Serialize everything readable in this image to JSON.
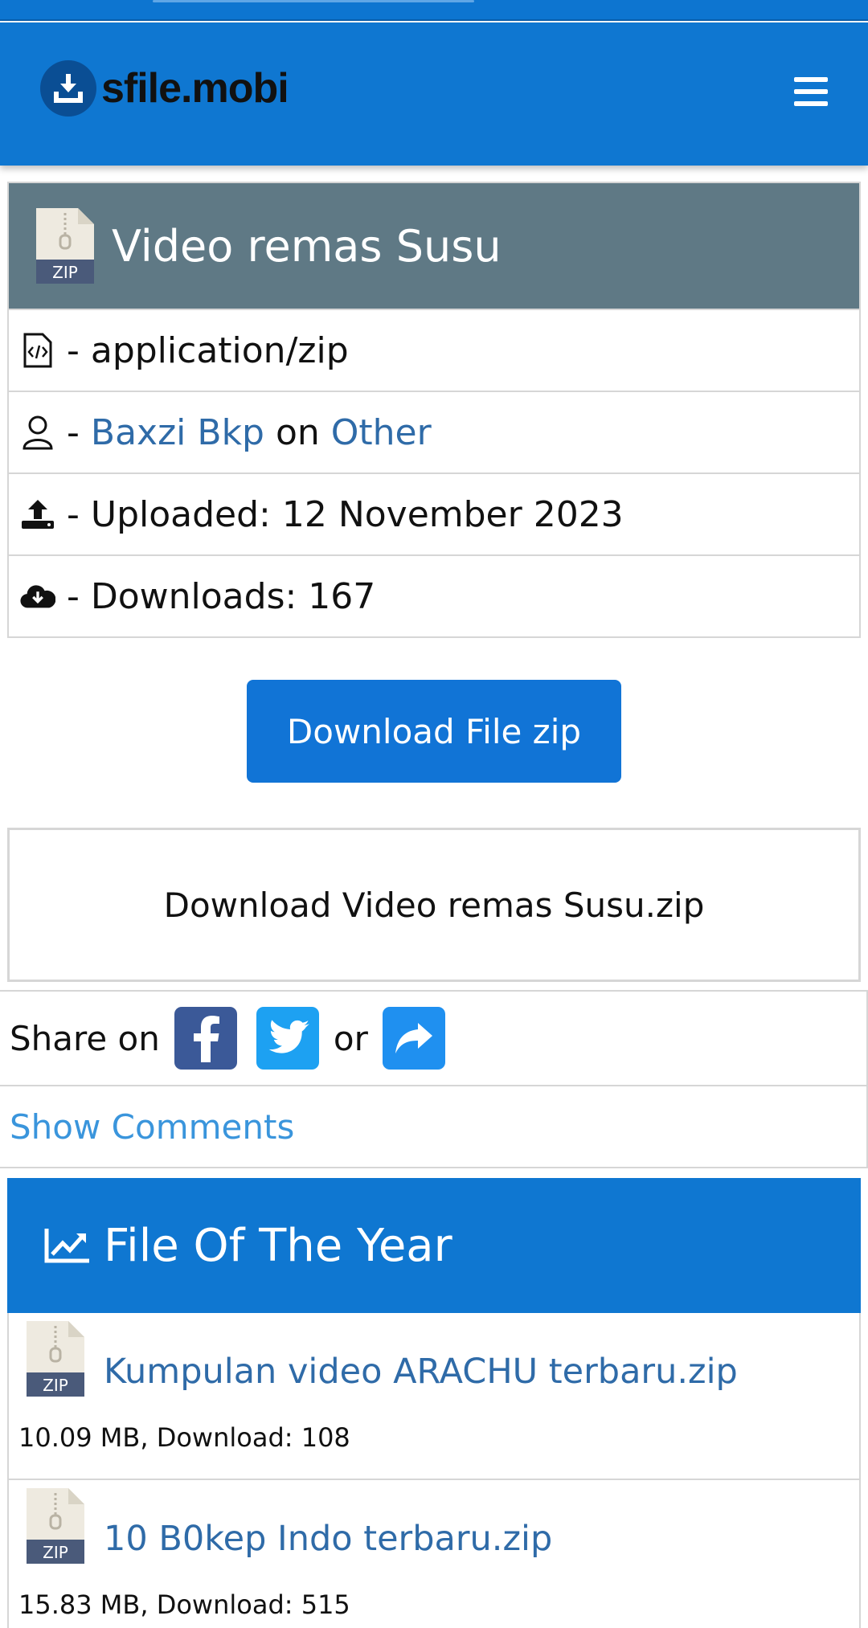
{
  "header": {
    "logo_text": "sfile.mobi",
    "menu_icon": "hamburger-icon"
  },
  "file": {
    "title": "Video remas Susu",
    "type_icon": "zip-file-icon",
    "mime": "- application/zip",
    "uploader_prefix": "- ",
    "uploader": "Baxzi Bkp",
    "on": " on ",
    "category": "Other",
    "uploaded": "- Uploaded: 12 November 2023",
    "downloads": "- Downloads: 167"
  },
  "download_button": "Download File zip",
  "download_box": "Download Video remas Susu.zip",
  "share": {
    "label": "Share on",
    "or": "or",
    "icons": [
      "facebook-icon",
      "twitter-icon",
      "share-icon"
    ]
  },
  "comments_link": "Show Comments",
  "file_of_the_year": {
    "title": "File Of The Year",
    "icon": "chart-line-icon",
    "items": [
      {
        "name": "Kumpulan video ARACHU terbaru.zip",
        "meta": "10.09 MB, Download: 108"
      },
      {
        "name": "10 B0kep Indo terbaru.zip",
        "meta": "15.83 MB, Download: 515"
      }
    ]
  },
  "colors": {
    "brand_blue": "#0f77d1",
    "title_bar": "#5f7985",
    "link": "#2f6ba8",
    "facebook": "#3b5998",
    "twitter": "#1da1f2"
  }
}
